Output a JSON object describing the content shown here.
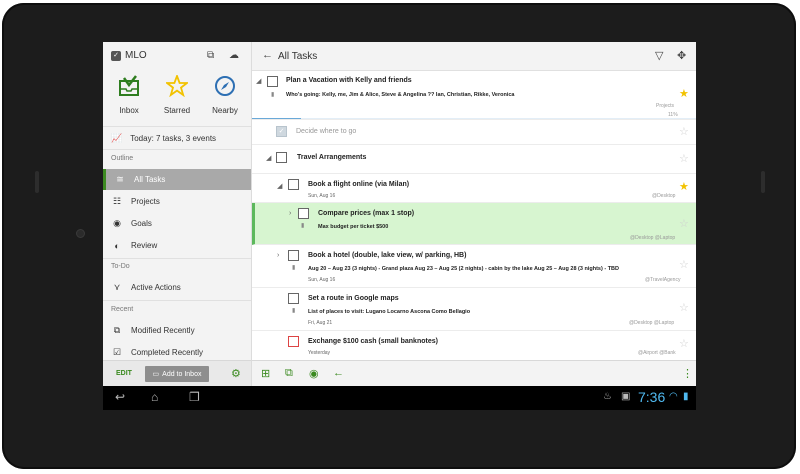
{
  "app": {
    "name": "MLO"
  },
  "quick_access": [
    {
      "label": "Inbox",
      "icon": "inbox-icon"
    },
    {
      "label": "Starred",
      "icon": "star-icon"
    },
    {
      "label": "Nearby",
      "icon": "compass-icon"
    }
  ],
  "today": {
    "text": "Today: 7 tasks, 3 events"
  },
  "sidebar": {
    "outline_label": "Outline",
    "outline": [
      {
        "label": "All Tasks",
        "icon": "all-tasks-icon"
      },
      {
        "label": "Projects",
        "icon": "projects-icon"
      },
      {
        "label": "Goals",
        "icon": "goals-icon"
      },
      {
        "label": "Review",
        "icon": "review-icon"
      }
    ],
    "todo_label": "To-Do",
    "todo": [
      {
        "label": "Active Actions",
        "icon": "active-actions-icon"
      }
    ],
    "recent_label": "Recent",
    "recent": [
      {
        "label": "Modified Recently",
        "icon": "modified-icon"
      },
      {
        "label": "Completed Recently",
        "icon": "completed-icon"
      }
    ]
  },
  "left_footer": {
    "edit": "EDIT",
    "add_inbox": "Add to Inbox"
  },
  "main": {
    "title": "All Tasks"
  },
  "tasks": [
    {
      "title": "Plan a Vacation with Kelly and friends",
      "note": "Who's going: Kelly, me, Jim & Alice, Steve & Angelina ?? Ian, Christian, Rikke, Veronica",
      "tag": "Projects",
      "progress_label": "11%",
      "progress": 0.11,
      "starred": true
    },
    {
      "title": "Decide where to go",
      "completed": true,
      "starred": false
    },
    {
      "title": "Travel Arrangements",
      "starred": false
    },
    {
      "title": "Book a flight online (via Milan)",
      "date": "Sun, Aug 16",
      "tag": "@Desktop",
      "starred": true
    },
    {
      "title": "Compare prices (max 1 stop)",
      "note": "Max budget per ticket $500",
      "tag": "@Desktop  @Laptop",
      "starred": false,
      "highlighted": true
    },
    {
      "title": "Book a hotel (double, lake view, w/ parking, HB)",
      "note": "Aug 20 – Aug 23 (3 nights) - cabin by the lake Aug 25 – Aug 28 (3 nights) - TBD",
      "note_full": "Aug 20 – Aug 23 (3 nights) - Grand plaza Aug 23 – Aug 25 (2 nights) - cabin by the lake Aug 25 – Aug 28 (3 nights) - TBD",
      "date": "Sun, Aug 16",
      "tag": "@TravelAgency",
      "starred": false
    },
    {
      "title": "Set a route in Google maps",
      "note": "List of places to visit: Lugano Locarno Ascona Como Bellagio",
      "date": "Fri, Aug 21",
      "tag": "@Desktop  @Laptop",
      "starred": false
    },
    {
      "title": "Exchange $100 cash (small banknotes)",
      "date": "Yesterday",
      "tag": "@Airport  @Bank",
      "starred": false
    }
  ],
  "status_bar": {
    "time": "7:36"
  },
  "colors": {
    "accent": "#3d8b22",
    "highlight": "#d7f5d0",
    "star": "#f2c200",
    "clock": "#4fb9f0"
  }
}
